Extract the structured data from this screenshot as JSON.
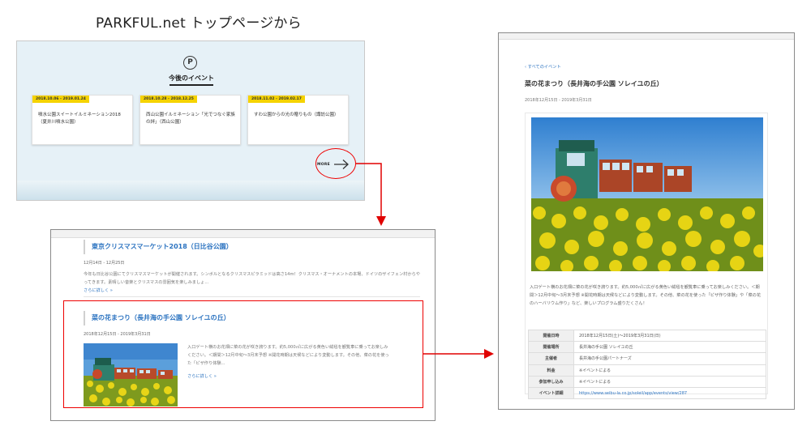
{
  "heading": "PARKFUL.net トップページから",
  "top_page": {
    "logo_glyph": "P",
    "section_title": "今後のイベント",
    "events": [
      {
        "date": "2018.10.06 - 2019.01.24",
        "title": "噴水公園スイートイルミネーション2018（夏井川噴水公園）"
      },
      {
        "date": "2018.10.28 - 2018.12.25",
        "title": "西山公園イルミネーション「光でつなぐ家族の絆」（西山公園）"
      },
      {
        "date": "2018.11.02 - 2019.02.17",
        "title": "すわ公園からの光の贈りもの（諏訪公園）"
      }
    ],
    "more_label": "MORE"
  },
  "event_list": {
    "items": [
      {
        "title": "東京クリスマスマーケット2018（日比谷公園）",
        "date": "12月14日 - 12月25日",
        "description": "今年も日比谷公園にてクリスマスマーケットが開催されます。シンボルとなるクリスマスピラミッドは高さ14m！クリスマス・オーナメントの本場、ドイツのザイフェン村からやってきます。素晴しい音楽とクリスマスの雰囲気を楽しみましょ...",
        "more_link": "さらに詳しく »"
      },
      {
        "title": "菜の花まつり（長井海の手公園 ソレイユの丘）",
        "date": "2018年12月15日 - 2019年3月31日",
        "description": "入口ゲート横のお花畑に菜の花が咲き誇ります。約5,000㎡に広がる黄色い絨毯を観覧車に乗ってお楽しみください。＜期間＞12月中旬〜3月末予想 ※開花時期は天候などにより変動します。その他、菜の花を使った「ピザ作り体験...",
        "more_link": "さらに詳しく »"
      }
    ]
  },
  "event_detail": {
    "back_link": "‹ すべてのイベント",
    "title": "菜の花まつり（長井海の手公園 ソレイユの丘）",
    "date": "2018年12月15日 - 2019年3月31日",
    "description": "入口ゲート横のお花畑に菜の花が咲き誇ります。約5,000㎡に広がる黄色い絨毯を観覧車に乗ってお楽しみください。＜期間＞12月中旬〜3月末予想 ※開花時期は天候などにより変動します。その他、菜の花を使った「ピザ作り体験」や「菜の花のハーバリウム作り」など、楽しいプログラム盛りだくさん！",
    "table": [
      {
        "key": "開催日時",
        "value": "2018年12月15日(土)～2019年3月31日(日)"
      },
      {
        "key": "開催場所",
        "value": "長井海の手公園 ソレイユの丘"
      },
      {
        "key": "主催者",
        "value": "長井海の手公園パートナーズ"
      },
      {
        "key": "料金",
        "value": "※イベントによる"
      },
      {
        "key": "参加申し込み",
        "value": "※イベントによる"
      },
      {
        "key": "イベント詳細",
        "value": "https://www.seibu-la.co.jp/soleil/app/events/view/287"
      }
    ]
  },
  "colors": {
    "link_blue": "#2a72c0",
    "badge_yellow": "#f5d300",
    "highlight_red": "#e00000"
  }
}
